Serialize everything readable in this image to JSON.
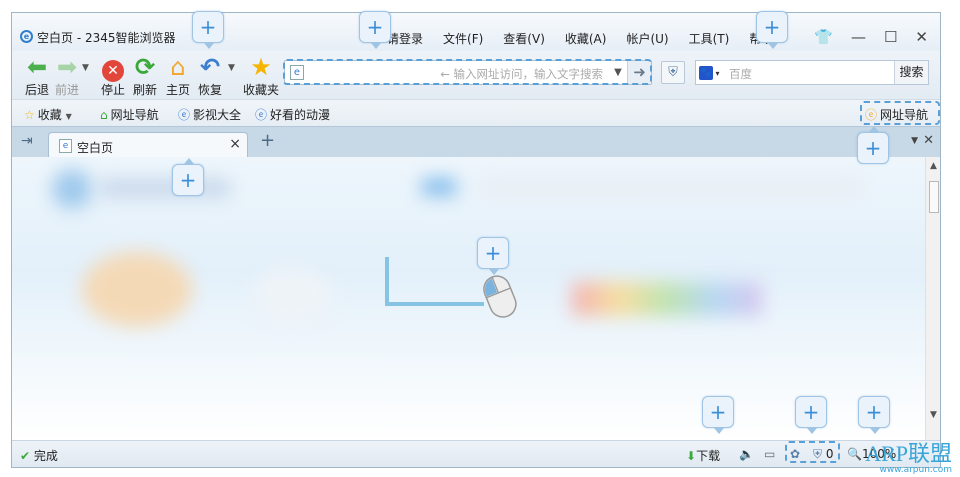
{
  "window": {
    "title": "空白页 - 2345智能浏览器",
    "menu": [
      "请登录",
      "文件(F)",
      "查看(V)",
      "收藏(A)",
      "帐户(U)",
      "工具(T)",
      "帮助"
    ],
    "controls": {
      "skin": "skin-icon",
      "minimize": "—",
      "maximize": "☐",
      "close": "✕"
    }
  },
  "toolbar": {
    "back": "后退",
    "forward": "前进",
    "stop": "停止",
    "refresh": "刷新",
    "home": "主页",
    "restore": "恢复",
    "favorites": "收藏夹"
  },
  "address": {
    "placeholder": "← 输入网址访问，输入文字搜索"
  },
  "search": {
    "engine": "百度",
    "placeholder": "百度",
    "button": "搜索"
  },
  "favbar": {
    "collect": "收藏",
    "items": [
      "网址导航",
      "影视大全",
      "好看的动漫"
    ],
    "right": "网址导航"
  },
  "tabs": [
    {
      "title": "空白页"
    }
  ],
  "status": {
    "text": "完成",
    "download": "下载",
    "count": "0",
    "zoom": "100%"
  },
  "watermark": {
    "title": "ARP联盟",
    "url": "www.arpun.com"
  },
  "callout_symbol": "+",
  "colors": {
    "accent": "#3b8ed6",
    "frame": "#9fb6c9",
    "dashed": "#5aa0d8"
  }
}
